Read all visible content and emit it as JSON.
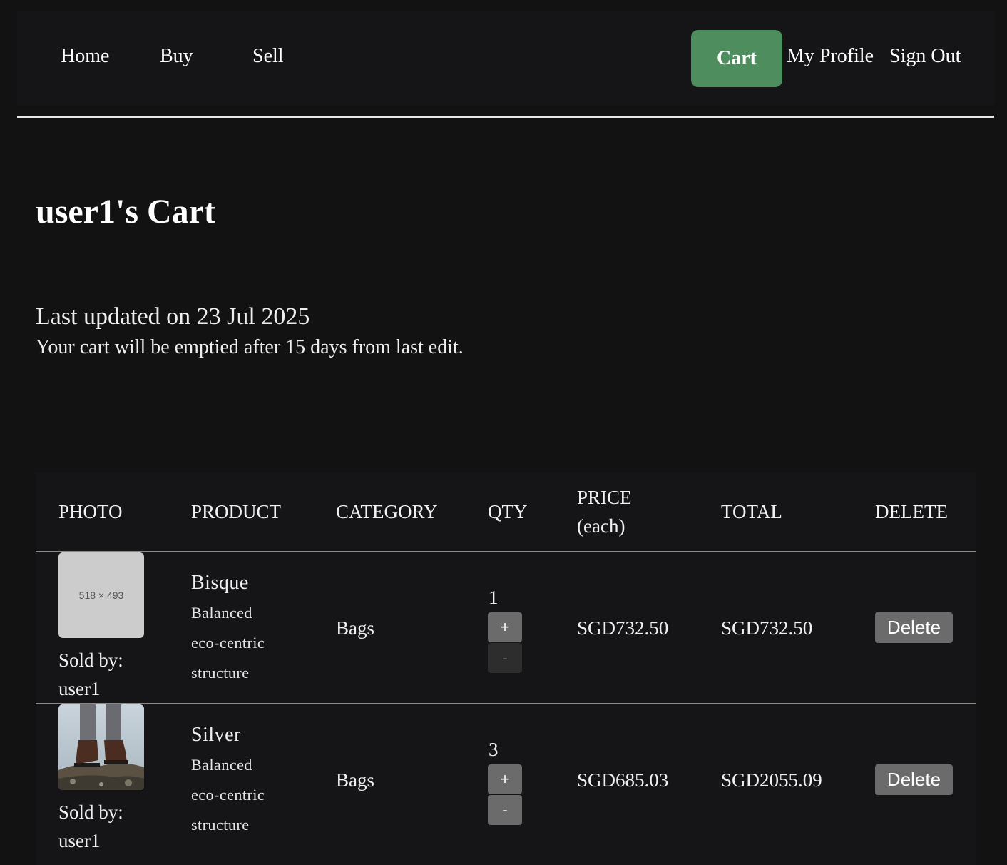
{
  "nav": {
    "home": "Home",
    "buy": "Buy",
    "sell": "Sell",
    "cart": "Cart",
    "my_profile": "My Profile",
    "sign_out": "Sign Out",
    "active_color": "#4e8d5d"
  },
  "page": {
    "title": "user1's Cart",
    "last_updated": "Last updated on 23 Jul 2025",
    "empty_note": "Your cart will be emptied after 15 days from last edit."
  },
  "table": {
    "headers": {
      "photo": "PHOTO",
      "product": "PRODUCT",
      "category": "CATEGORY",
      "qty": "QTY",
      "price_line1": "PRICE",
      "price_line2": "(each)",
      "total": "TOTAL",
      "delete": "DELETE"
    },
    "rows": [
      {
        "photo_label": "518 × 493",
        "photo_icon": "image-placeholder-icon",
        "sold_by_label": "Sold by:",
        "seller": "user1",
        "name": "Bisque",
        "desc_line1": "Balanced",
        "desc_line2": "eco-centric",
        "desc_line3": "structure",
        "category": "Bags",
        "qty": "1",
        "plus": "+",
        "minus": "-",
        "price": "SGD732.50",
        "total": "SGD732.50",
        "delete": "Delete"
      },
      {
        "photo_icon": "boots-photo",
        "sold_by_label": "Sold by:",
        "seller": "user1",
        "name": "Silver",
        "desc_line1": "Balanced",
        "desc_line2": "eco-centric",
        "desc_line3": "structure",
        "category": "Bags",
        "qty": "3",
        "plus": "+",
        "minus": "-",
        "price": "SGD685.03",
        "total": "SGD2055.09",
        "delete": "Delete"
      }
    ]
  }
}
